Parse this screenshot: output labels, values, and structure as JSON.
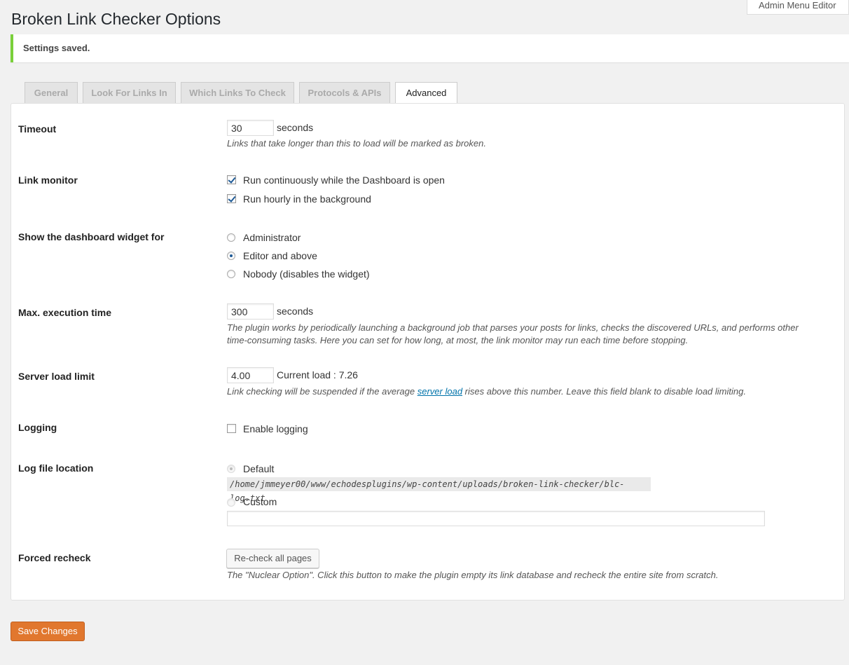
{
  "admin_menu_editor": "Admin Menu Editor",
  "page_title": "Broken Link Checker Options",
  "notice": "Settings saved.",
  "tabs": [
    {
      "label": "General",
      "active": false
    },
    {
      "label": "Look For Links In",
      "active": false
    },
    {
      "label": "Which Links To Check",
      "active": false
    },
    {
      "label": "Protocols & APIs",
      "active": false
    },
    {
      "label": "Advanced",
      "active": true
    }
  ],
  "settings": {
    "timeout": {
      "label": "Timeout",
      "value": "30",
      "unit": "seconds",
      "description": "Links that take longer than this to load will be marked as broken."
    },
    "link_monitor": {
      "label": "Link monitor",
      "options": [
        {
          "label": "Run continuously while the Dashboard is open",
          "checked": true
        },
        {
          "label": "Run hourly in the background",
          "checked": true
        }
      ]
    },
    "dashboard_widget": {
      "label": "Show the dashboard widget for",
      "options": [
        {
          "label": "Administrator",
          "selected": false
        },
        {
          "label": "Editor and above",
          "selected": true
        },
        {
          "label": "Nobody (disables the widget)",
          "selected": false
        }
      ]
    },
    "max_execution": {
      "label": "Max. execution time",
      "value": "300",
      "unit": "seconds",
      "description_line1": "The plugin works by periodically launching a background job that parses your posts for links, checks the discovered URLs, and performs other",
      "description_line2": "time-consuming tasks. Here you can set for how long, at most, the link monitor may run each time before stopping."
    },
    "server_load": {
      "label": "Server load limit",
      "value": "4.00",
      "current_load": "Current load : 7.26",
      "description_before": "Link checking will be suspended if the average ",
      "description_link": "server load",
      "description_after": " rises above this number. Leave this field blank to disable load limiting."
    },
    "logging": {
      "label": "Logging",
      "option": "Enable logging",
      "checked": false
    },
    "log_file": {
      "label": "Log file location",
      "default_label": "Default",
      "default_path": "/home/jmmeyer00/www/echodesplugins/wp-content/uploads/broken-link-checker/blc-log.txt",
      "custom_label": "Custom",
      "custom_value": ""
    },
    "forced_recheck": {
      "label": "Forced recheck",
      "button": "Re-check all pages",
      "description": "The \"Nuclear Option\". Click this button to make the plugin empty its link database and recheck the entire site from scratch."
    }
  },
  "save_button": "Save Changes"
}
